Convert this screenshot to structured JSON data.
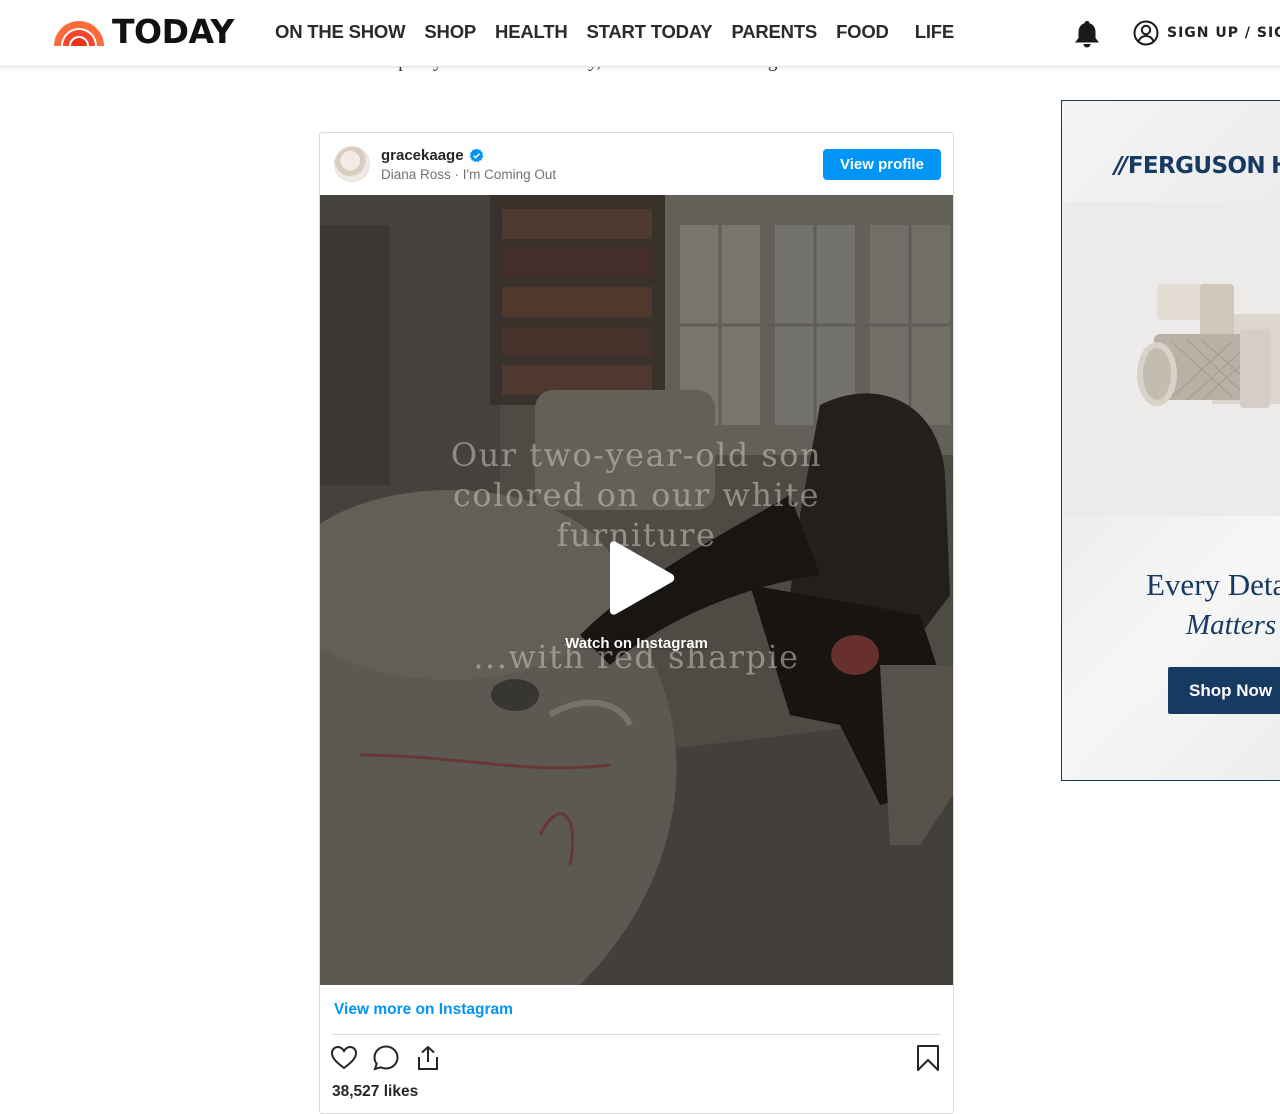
{
  "header": {
    "logo_text": "TODAY",
    "nav": [
      "ON THE SHOW",
      "SHOP",
      "HEALTH",
      "START TODAY",
      "PARENTS",
      "FOOD",
      "LIFE"
    ],
    "notifications_icon": "bell-icon",
    "account_icon": "user-circle-icon",
    "signup_label": "SIGN UP / SIGN"
  },
  "article": {
    "fragment": "handled it pretty much the same way, and she never did it again."
  },
  "instagram": {
    "username": "gracekaage",
    "audio": "Diana Ross · I'm Coming Out",
    "view_profile": "View profile",
    "overlay_line1": "Our two-year-old son",
    "overlay_line2": "colored on our white",
    "overlay_line3": "furniture",
    "overlay_line4": "...with red sharpie",
    "watch_label": "Watch on Instagram",
    "view_more": "View more on Instagram",
    "likes": "38,527 likes",
    "icons": [
      "heart-icon",
      "comment-icon",
      "share-icon",
      "bookmark-icon",
      "play-icon",
      "verified-icon"
    ]
  },
  "ad": {
    "brand": "FERGUSON",
    "brand_suffix": "H",
    "headline": "Every Deta",
    "subline": "Matters",
    "cta": "Shop Now"
  },
  "colors": {
    "instagram_blue": "#0095f6",
    "today_orange": "#ff5a36",
    "ferguson_navy": "#173a63"
  }
}
